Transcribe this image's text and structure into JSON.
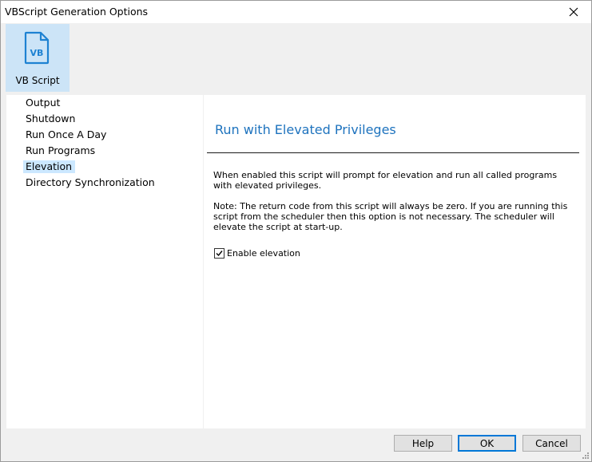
{
  "window": {
    "title": "VBScript Generation Options"
  },
  "toolbar": {
    "tile_label": "VB Script",
    "tile_icon": "vb-script-file-icon",
    "icon_text": "VB"
  },
  "nav": {
    "items": [
      {
        "label": "Output"
      },
      {
        "label": "Shutdown"
      },
      {
        "label": "Run Once A Day"
      },
      {
        "label": "Run Programs"
      },
      {
        "label": "Elevation",
        "selected": true
      },
      {
        "label": "Directory Synchronization"
      }
    ]
  },
  "content": {
    "heading": "Run with Elevated Privileges",
    "description": "When enabled this script will prompt for elevation and run all called programs with elevated privileges.",
    "note": "Note: The return code from this script will always be zero. If you are running this script from the scheduler then this option is not necessary. The scheduler will elevate the script at start-up.",
    "checkbox": {
      "label": "Enable elevation",
      "checked": true
    }
  },
  "buttons": {
    "help": "Help",
    "ok": "OK",
    "cancel": "Cancel"
  },
  "colors": {
    "accent": "#1e73be",
    "selection": "#cce8ff",
    "tile": "#cce4f7"
  }
}
